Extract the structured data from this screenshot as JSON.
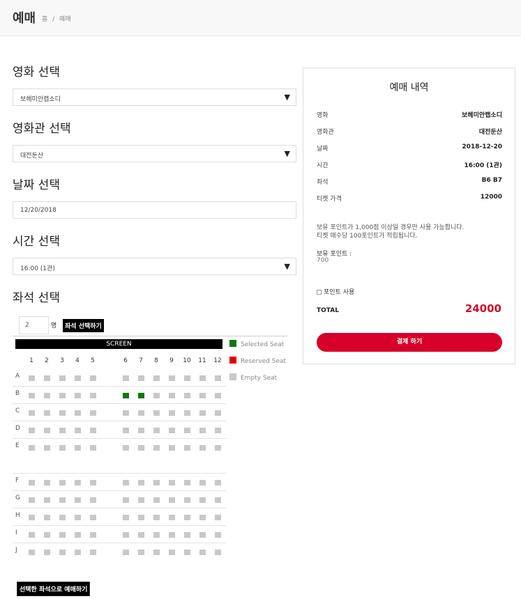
{
  "header": {
    "title": "예매",
    "breadcrumb": [
      "홈",
      "/",
      "예매"
    ]
  },
  "sections": {
    "movie_title": "영화 선택",
    "theater_title": "영화관 선택",
    "date_title": "날짜 선택",
    "time_title": "시간 선택",
    "seat_title": "좌석 선택"
  },
  "selects": {
    "movie": "보헤미안랩소디",
    "theater": "대전둔산",
    "date": "12/20/2018",
    "time": "16:00 (1관)",
    "arrow": "▼"
  },
  "seat_picker": {
    "count": "2",
    "unit": "명",
    "select_button": "좌석 선택하기",
    "screen_label": "SCREEN",
    "book_button": "선택한 좌석으로 예매하기",
    "legend": [
      {
        "label": "Selected Seat",
        "color": "#0a7a0a"
      },
      {
        "label": "Reserved Seat",
        "color": "#e00000"
      },
      {
        "label": "Empty Seat",
        "color": "#c8c8c8"
      }
    ],
    "columns": [
      "1",
      "2",
      "3",
      "4",
      "5",
      "6",
      "7",
      "8",
      "9",
      "10",
      "11",
      "12"
    ],
    "rows": [
      "A",
      "B",
      "C",
      "D",
      "E",
      "F",
      "G",
      "H",
      "I",
      "J"
    ],
    "selected_seats": [
      "B6",
      "B7"
    ]
  },
  "summary": {
    "title": "예매 내역",
    "rows": [
      {
        "key": "영화",
        "value": "보헤미안랩소디"
      },
      {
        "key": "영화관",
        "value": "대전둔산"
      },
      {
        "key": "날짜",
        "value": "2018-12-20"
      },
      {
        "key": "시간",
        "value": "16:00 (1관)"
      },
      {
        "key": "좌석",
        "value": "B6 B7"
      },
      {
        "key": "티켓 가격",
        "value": "12000"
      }
    ],
    "notice_line1": "보유 포인트가 1,000점 이상일 경우만 사용 가능합니다.",
    "notice_line2": "티켓 매수당 100포인트가 적립됩니다.",
    "points_label": "보유 포인트 :",
    "points_value": "700",
    "use_points_label": "포인트 사용",
    "total_label": "TOTAL",
    "total_value": "24000",
    "pay_button": "결제 하기"
  }
}
